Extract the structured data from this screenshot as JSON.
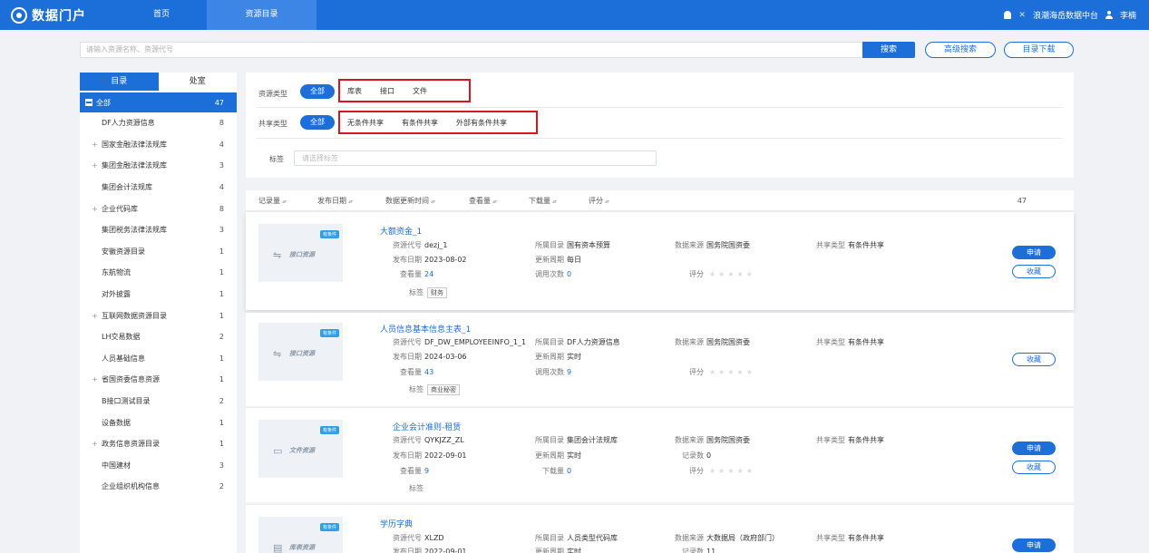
{
  "header": {
    "logo": "数据门户",
    "nav": [
      "首页",
      "资源目录"
    ],
    "platform": "浪潮海岳数据中台",
    "user": "李楠"
  },
  "search": {
    "placeholder": "请输入资源名称、资源代号",
    "search_btn": "搜索",
    "advanced_btn": "高级搜索",
    "download_btn": "目录下载"
  },
  "sidebar": {
    "tabs": [
      "目录",
      "处室"
    ],
    "root": {
      "label": "全部",
      "count": "47"
    },
    "items": [
      {
        "label": "DF人力资源信息",
        "count": "8"
      },
      {
        "label": "国家金融法律法规库",
        "count": "4"
      },
      {
        "label": "集团金融法律法规库",
        "count": "3"
      },
      {
        "label": "集团会计法规库",
        "count": "4"
      },
      {
        "label": "企业代码库",
        "count": "8"
      },
      {
        "label": "集团税务法律法规库",
        "count": "3"
      },
      {
        "label": "安徽资源目录",
        "count": "1"
      },
      {
        "label": "东航物流",
        "count": "1"
      },
      {
        "label": "对外披露",
        "count": "1"
      },
      {
        "label": "互联网数据资源目录",
        "count": "1"
      },
      {
        "label": "LH交易数据",
        "count": "2"
      },
      {
        "label": "人员基础信息",
        "count": "1"
      },
      {
        "label": "省国资委信息资源",
        "count": "1"
      },
      {
        "label": "B接口测试目录",
        "count": "2"
      },
      {
        "label": "设备数据",
        "count": "1"
      },
      {
        "label": "政务信息资源目录",
        "count": "1"
      },
      {
        "label": "中国建材",
        "count": "3"
      },
      {
        "label": "企业组织机构信息",
        "count": "2"
      }
    ]
  },
  "filters": {
    "resource_type_label": "资源类型",
    "share_type_label": "共享类型",
    "all": "全部",
    "resource_types": [
      "库表",
      "接口",
      "文件"
    ],
    "share_types": [
      "无条件共享",
      "有条件共享",
      "外部有条件共享"
    ],
    "tag_label": "标签",
    "tag_placeholder": "请选择标签"
  },
  "sort": {
    "items": [
      "记录量",
      "发布日期",
      "数据更新时间",
      "查看量",
      "下载量",
      "评分"
    ],
    "total": "47"
  },
  "labels": {
    "code": "资源代号",
    "pub_date": "发布日期",
    "views": "查看量",
    "tag": "标签",
    "catalog": "所属目录",
    "update_cycle": "更新周期",
    "calls": "调用次数",
    "downloads": "下载量",
    "source": "数据来源",
    "records": "记录数",
    "rating": "评分",
    "share_type": "共享类型",
    "apply": "申请",
    "favorite": "收藏",
    "badge": "有条件"
  },
  "results": [
    {
      "title": "大额资金_1",
      "thumb": "接口资源",
      "code": "dezj_1",
      "pub_date": "2023-08-02",
      "views": "24",
      "tag": "财务",
      "catalog": "国有资本预算",
      "update_cycle": "每日",
      "calls": "0",
      "source": "国务院国资委",
      "share_type": "有条件共享"
    },
    {
      "title": "人员信息基本信息主表_1",
      "thumb": "接口资源",
      "code": "DF_DW_EMPLOYEEINFO_1_1",
      "pub_date": "2024-03-06",
      "views": "43",
      "tag": "商业秘密",
      "catalog": "DF人力资源信息",
      "update_cycle": "实时",
      "calls": "9",
      "source": "国务院国资委",
      "share_type": "有条件共享"
    },
    {
      "title": "企业会计准则-租赁",
      "thumb": "文件资源",
      "code": "QYKJZZ_ZL",
      "pub_date": "2022-09-01",
      "views": "9",
      "catalog": "集团会计法规库",
      "update_cycle": "实时",
      "downloads": "0",
      "source": "国务院国资委",
      "records": "0",
      "share_type": "有条件共享"
    },
    {
      "title": "学历字典",
      "thumb": "库表资源",
      "code": "XLZD",
      "pub_date": "2022-09-01",
      "catalog": "人员类型代码库",
      "update_cycle": "实时",
      "source": "大数据局（政府部门）",
      "records": "11",
      "share_type": "有条件共享"
    }
  ]
}
